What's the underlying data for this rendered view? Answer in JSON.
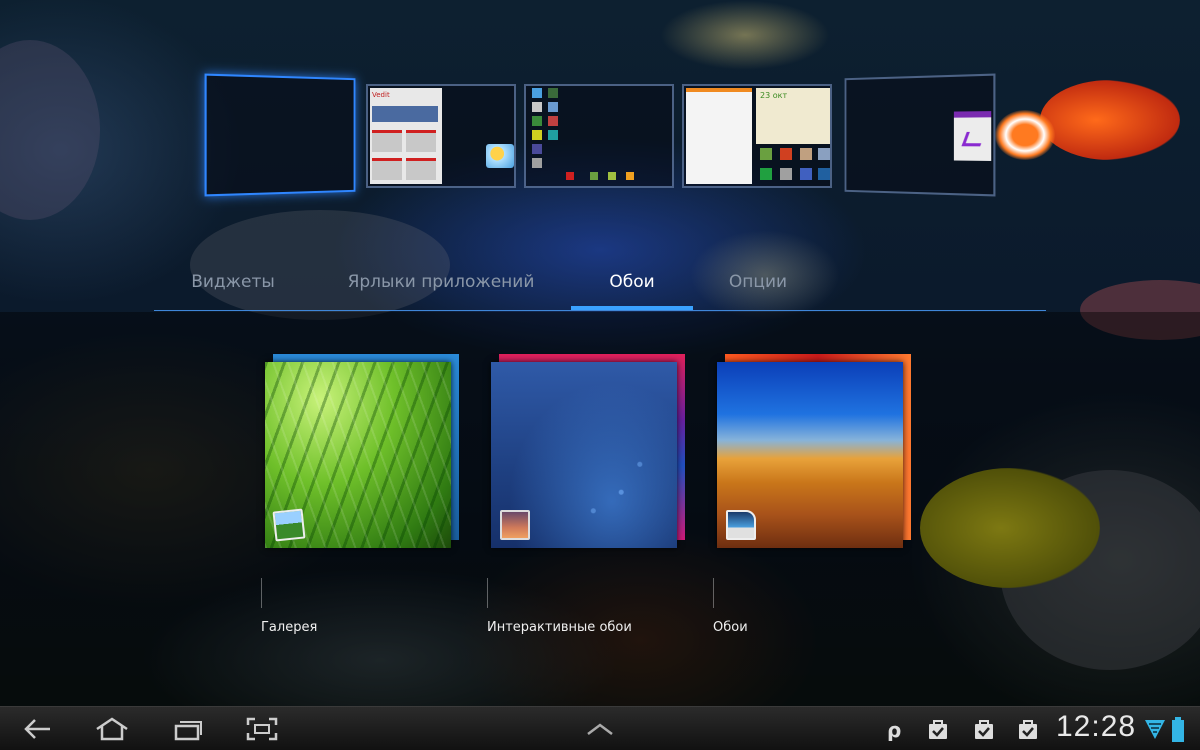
{
  "tabs": [
    {
      "label": "Виджеты"
    },
    {
      "label": "Ярлыки приложений"
    },
    {
      "label": "Обои"
    },
    {
      "label": "Опции"
    }
  ],
  "selected_tab": "Обои",
  "thumb_texts": {
    "screen2_header": "Vedit",
    "screen4_date": "23 окт"
  },
  "items": [
    {
      "label": "Галерея"
    },
    {
      "label": "Интерактивные обои"
    },
    {
      "label": "Обои"
    }
  ],
  "status": {
    "time": "12:28"
  },
  "colors": {
    "accent": "#3aa2ff",
    "tab_inactive": "#8a97a8",
    "tab_active": "#ffffff"
  },
  "icons": {
    "nav": [
      "back-icon",
      "home-icon",
      "recent-apps-icon",
      "screenshot-icon",
      "up-arrow-icon"
    ],
    "notifications": [
      "p-icon",
      "shopping-bag-icon",
      "shopping-bag-icon",
      "shopping-bag-icon",
      "wifi-icon",
      "battery-icon"
    ]
  }
}
